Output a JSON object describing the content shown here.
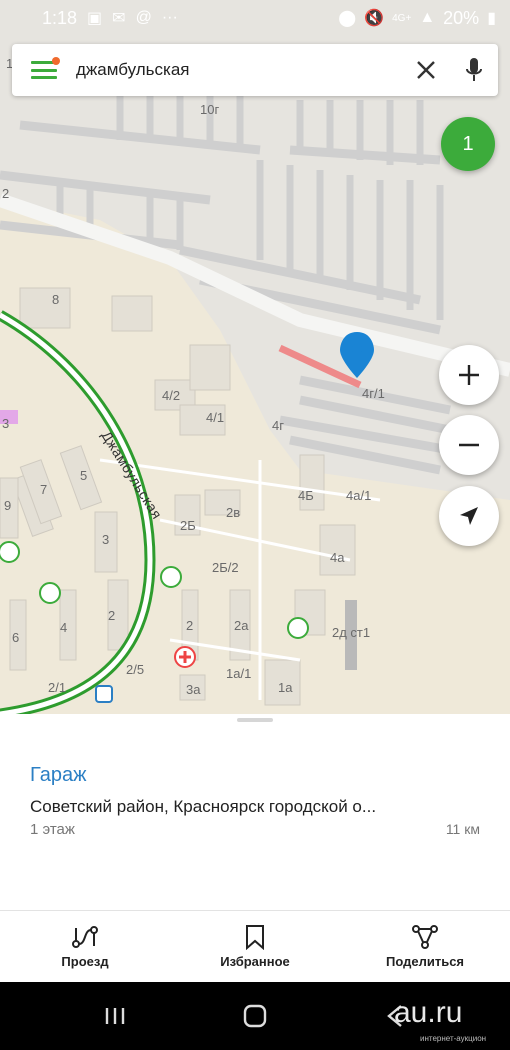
{
  "status_bar": {
    "time": "1:18",
    "battery": "20%",
    "network": "4G+",
    "left_icons": [
      "photo-icon",
      "mail-icon",
      "at-icon",
      "more-icon"
    ],
    "right_icons": [
      "location-icon",
      "mute-icon",
      "signal-icon",
      "battery-icon"
    ]
  },
  "search": {
    "value": "джамбульская",
    "placeholder": ""
  },
  "results_count": "1",
  "map": {
    "street": "Джамбульская",
    "labels": [
      "10г",
      "8",
      "4/2",
      "4/1",
      "4г/1",
      "4г",
      "4Б",
      "4а/1",
      "5",
      "7",
      "9",
      "3",
      "2Б",
      "2в",
      "2Б/2",
      "4а",
      "2",
      "2а",
      "2д ст1",
      "6",
      "4",
      "1а/1",
      "1а",
      "3а",
      "2/1",
      "2/5",
      "1",
      "2",
      "3"
    ],
    "accent_green": "#3cab3b",
    "pin_color": "#1a84d4",
    "highlight_color": "#f08080"
  },
  "card": {
    "title": "Гараж",
    "address": "Советский район, Красноярск городской о...",
    "floor": "1 этаж",
    "distance": "11 км"
  },
  "actions": [
    {
      "label": "Проезд",
      "icon": "route-icon"
    },
    {
      "label": "Избранное",
      "icon": "bookmark-icon"
    },
    {
      "label": "Поделиться",
      "icon": "share-icon"
    }
  ],
  "watermark": {
    "logo": "au.ru",
    "subtitle": "интернет-аукцион"
  }
}
